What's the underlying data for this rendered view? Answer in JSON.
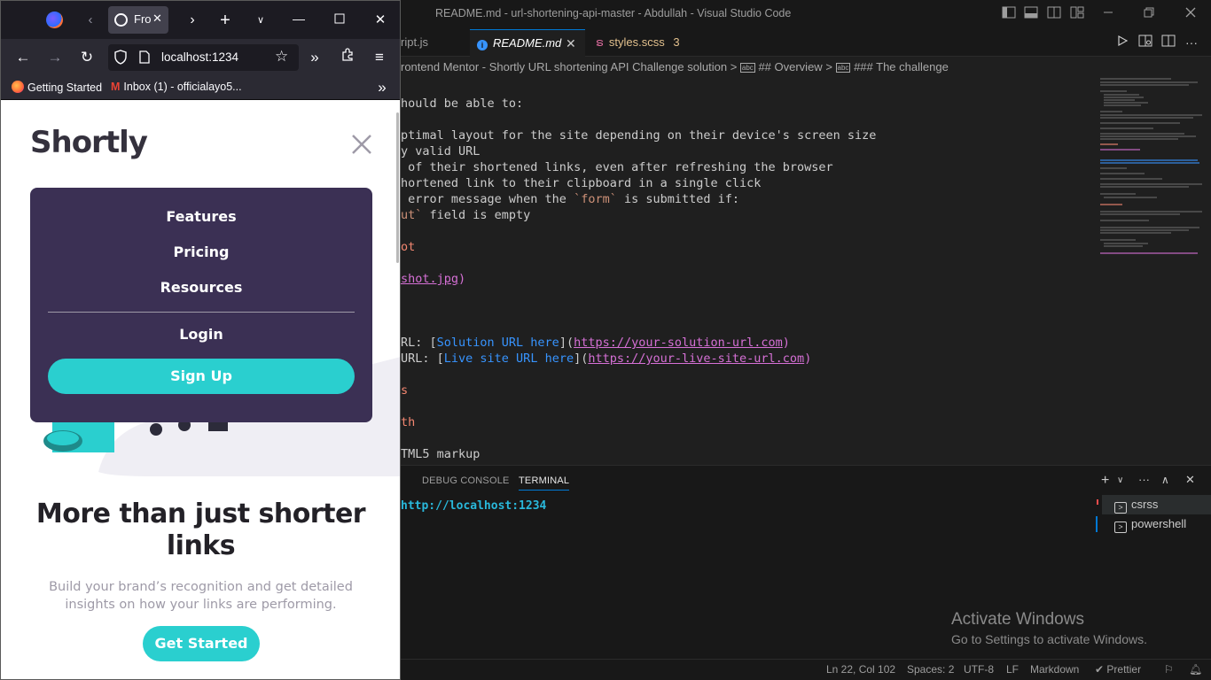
{
  "vscode": {
    "title": "README.md - url-shortening-api-master - Abdullah - Visual Studio Code",
    "tabs": [
      {
        "label": "ript.js"
      },
      {
        "label": "README.md"
      },
      {
        "label": "styles.scss",
        "badge": "3"
      }
    ],
    "breadcrumb": {
      "part1": "rontend Mentor - Shortly URL shortening API Challenge solution",
      "part2": "## Overview",
      "part3": "### The challenge"
    },
    "code": {
      "l1": "hould be able to:",
      "l2": "ptimal layout for the site depending on their device's screen size",
      "l3": "y valid URL",
      "l4": " of their shortened links, even after refreshing the browser",
      "l5": "hortened link to their clipboard in a single click",
      "l6a": " error message when the ",
      "l6b": "`form`",
      "l6c": " is submitted if:",
      "l7a": "ut`",
      "l7b": " field is empty",
      "l8": "ot",
      "l9a": "shot.jpg",
      "l9b": ")",
      "l10a": "RL: [",
      "l10b": "Solution URL here",
      "l10c": "](",
      "l10d": "https://your-solution-url.com",
      "l10e": ")",
      "l11a": "URL: [",
      "l11b": "Live site URL here",
      "l11c": "](",
      "l11d": "https://your-live-site-url.com",
      "l11e": ")",
      "l12": "s",
      "l13": "th",
      "l14": "TML5 markup"
    },
    "panel": {
      "tab_debug": "DEBUG CONSOLE",
      "tab_terminal": "TERMINAL",
      "terminal_line": "http://localhost:1234",
      "terminals": [
        "csrss",
        "powershell"
      ]
    },
    "status": {
      "position": "Ln 22, Col 102",
      "spaces": "Spaces: 2",
      "encoding": "UTF-8",
      "eol": "LF",
      "language": "Markdown",
      "prettier": "Prettier"
    },
    "watermark": {
      "title": "Activate Windows",
      "sub": "Go to Settings to activate Windows."
    },
    "colors": {
      "accent": "#0078d4",
      "link": "#d670d6",
      "bracket_text": "#3794ff",
      "code_string": "#ce9178",
      "terminal_link": "#29b8db"
    }
  },
  "firefox": {
    "tab_label": "Fro",
    "url": "localhost:1234",
    "bookmarks": [
      "Getting Started",
      "Inbox (1) - officialayo5..."
    ]
  },
  "site": {
    "logo": "Shortly",
    "menu": [
      "Features",
      "Pricing",
      "Resources"
    ],
    "login": "Login",
    "signup": "Sign Up",
    "hero_title": "More than just shorter links",
    "hero_sub": "Build your brand’s recognition and get detailed insights on how your links are performing.",
    "cta": "Get Started",
    "colors": {
      "primary": "#2acfcf",
      "dark_violet": "#3b3054",
      "heading": "#34313d",
      "gray": "#9e9aa7"
    }
  }
}
